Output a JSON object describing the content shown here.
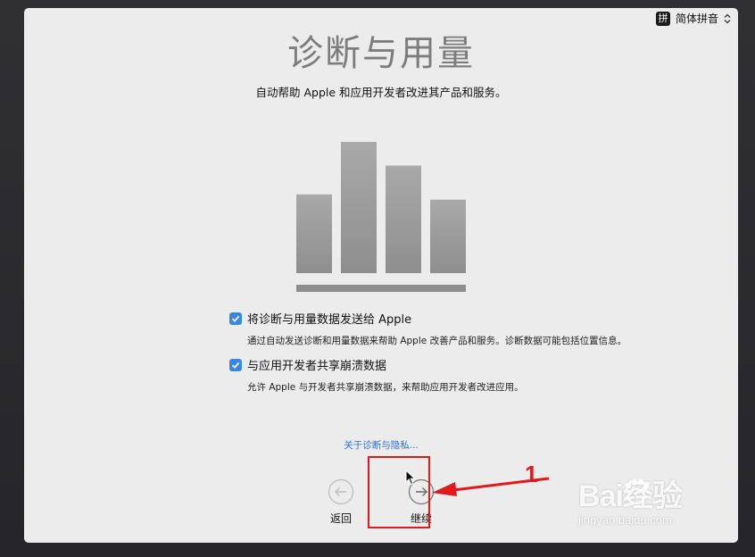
{
  "input_menu": {
    "badge": "拼",
    "label": "简体拼音"
  },
  "page": {
    "title": "诊断与用量",
    "subtitle": "自动帮助 Apple 和应用开发者改进其产品和服务。"
  },
  "illustration": {
    "bars": [
      0.6,
      1.0,
      0.82,
      0.56
    ],
    "color": "#8e8e8e"
  },
  "options": [
    {
      "label": "将诊断与用量数据发送给 Apple",
      "checked": true,
      "description": "通过自动发送诊断和用量数据来帮助 Apple 改善产品和服务。诊断数据可能包括位置信息。"
    },
    {
      "label": "与应用开发者共享崩溃数据",
      "checked": true,
      "description": "允许 Apple 与开发者共享崩溃数据，来帮助应用开发者改进应用。"
    }
  ],
  "privacy_link": "关于诊断与隐私...",
  "nav": {
    "back_label": "返回",
    "continue_label": "继续"
  },
  "annotation": {
    "number": "1",
    "color": "#e0191d"
  },
  "watermark": {
    "logo": "Bai经验",
    "url": "jingyan.baidu.com"
  },
  "colors": {
    "accent": "#3b86e0",
    "link": "#2f6fd1"
  }
}
